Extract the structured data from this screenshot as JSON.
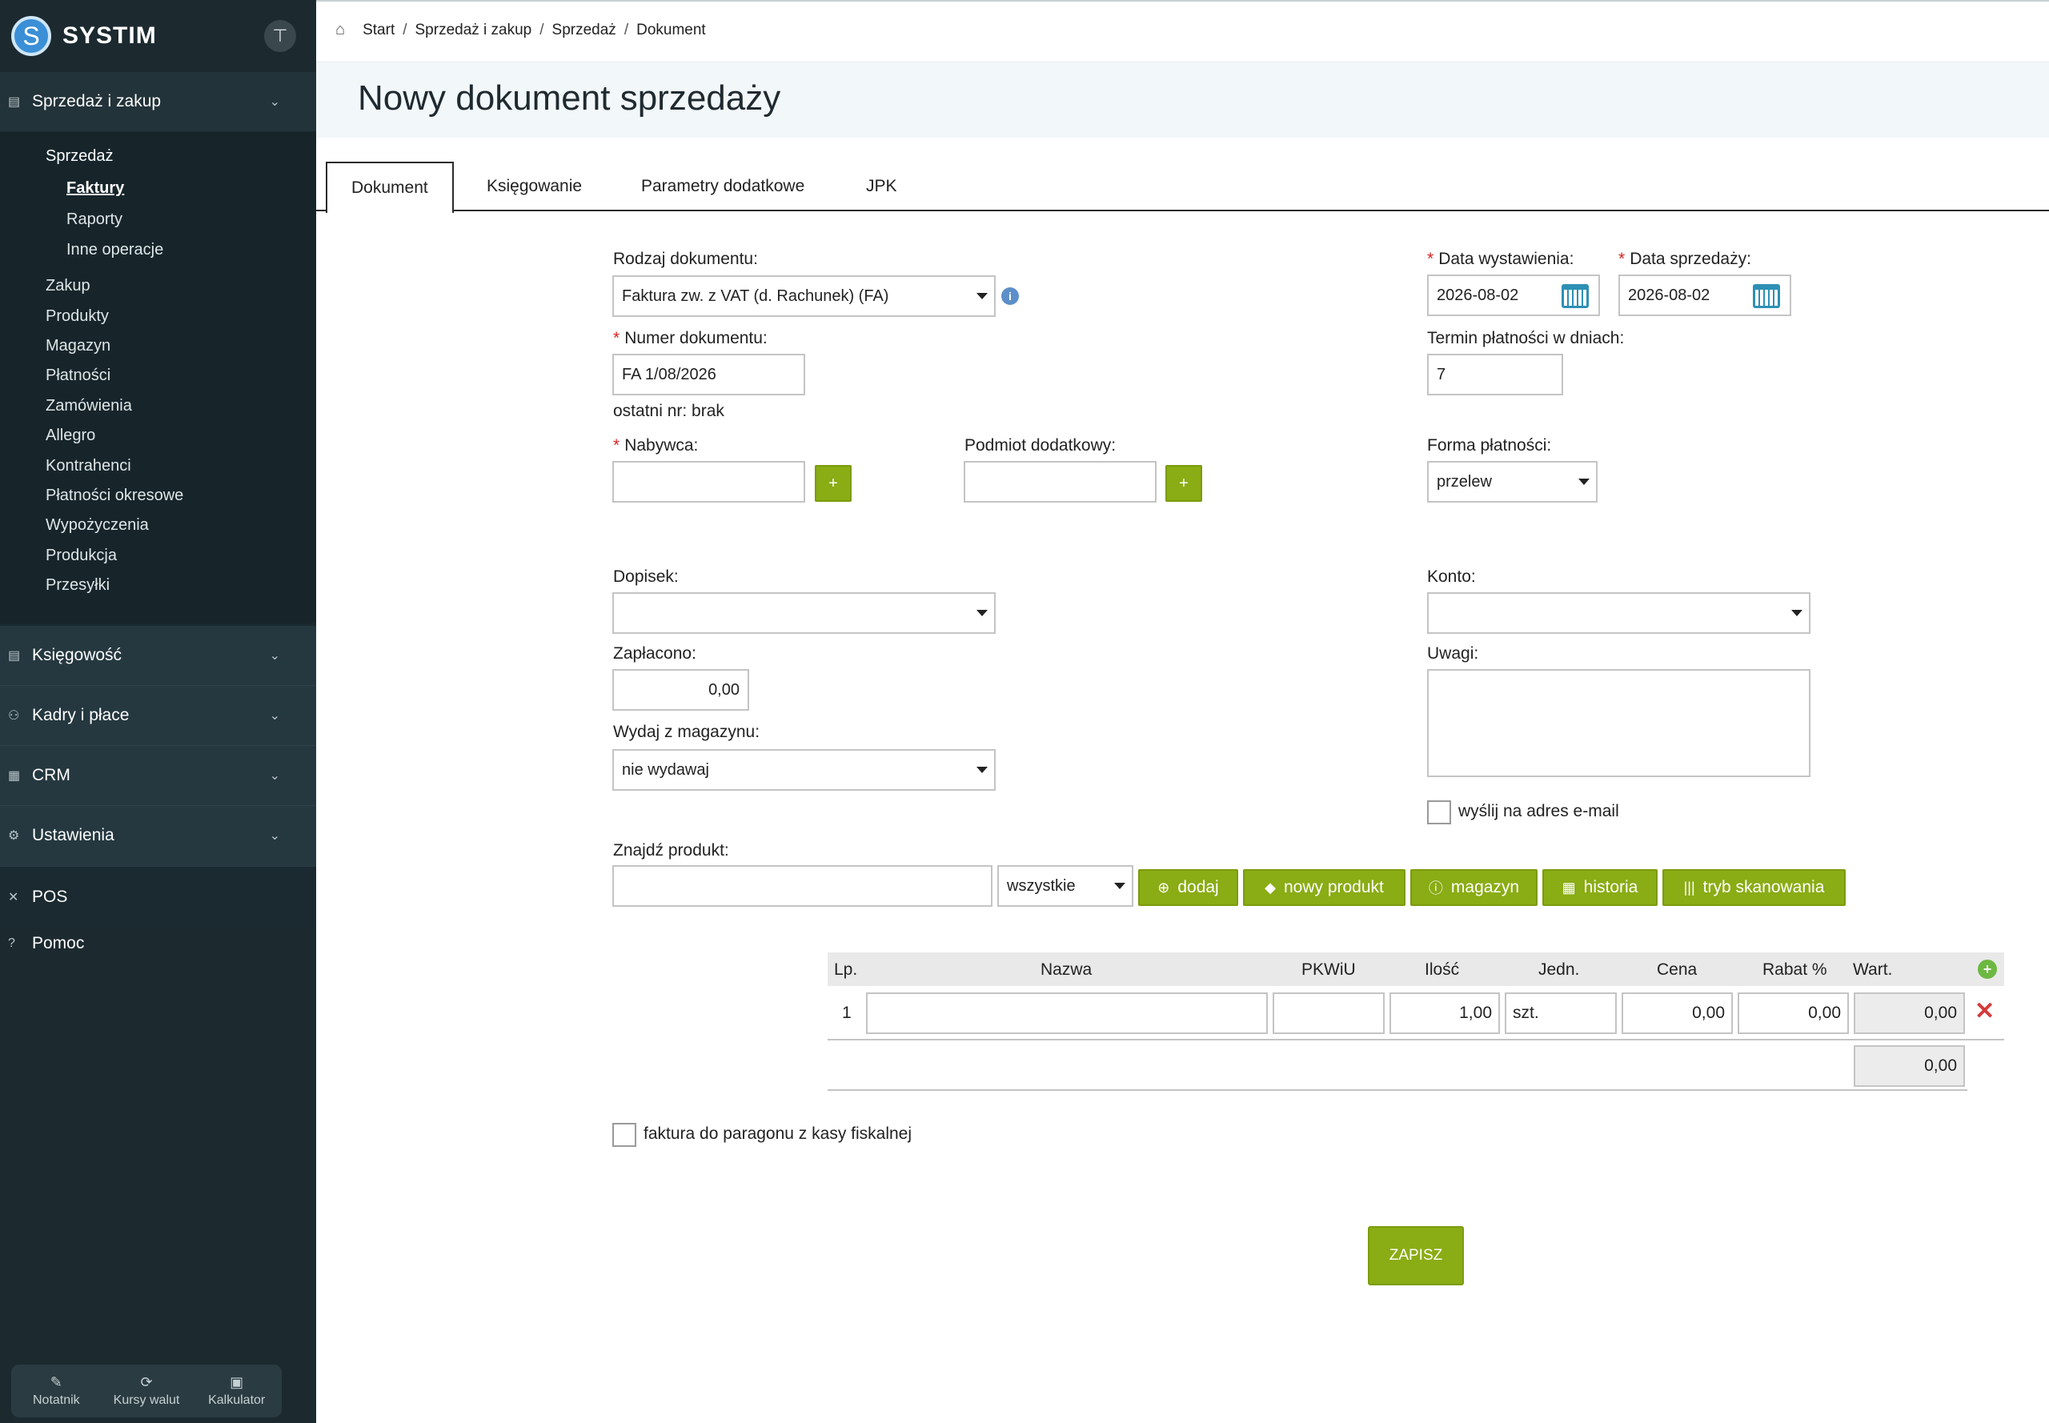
{
  "sidebar": {
    "brand": "SYSTIM",
    "logo_letter": "S",
    "sections": {
      "sales": "Sprzedaż i zakup",
      "accounting": "Księgowość",
      "hr": "Kadry i płace",
      "crm": "CRM",
      "settings": "Ustawienia",
      "pos": "POS",
      "help": "Pomoc"
    },
    "sub": {
      "sprzedaz": "Sprzedaż",
      "faktury": "Faktury",
      "raporty": "Raporty",
      "inne": "Inne operacje",
      "zakup": "Zakup",
      "produkty": "Produkty",
      "magazyn": "Magazyn",
      "platnosci": "Płatności",
      "zamowienia": "Zamówienia",
      "allegro": "Allegro",
      "kontrahenci": "Kontrahenci",
      "platnosci_okresowe": "Płatności okresowe",
      "wypozyczenia": "Wypożyczenia",
      "produkcja": "Produkcja",
      "przesylki": "Przesyłki"
    },
    "tools": {
      "notatnik": "Notatnik",
      "kursy": "Kursy walut",
      "kalkulator": "Kalkulator"
    }
  },
  "breadcrumb": {
    "start": "Start",
    "sales": "Sprzedaż i zakup",
    "sprzedaz": "Sprzedaż",
    "doc": "Dokument"
  },
  "page_title": "Nowy dokument sprzedaży",
  "tabs": {
    "dokument": "Dokument",
    "ksiegowanie": "Księgowanie",
    "parametry": "Parametry dodatkowe",
    "jpk": "JPK"
  },
  "form": {
    "rodzaj_label": "Rodzaj dokumentu:",
    "rodzaj_value": "Faktura zw. z VAT (d. Rachunek) (FA)",
    "numer_label": "Numer dokumentu:",
    "numer_value": "FA 1/08/2026",
    "ostatni": "ostatni nr: brak",
    "nabywca_label": "Nabywca:",
    "nabywca_value": "",
    "podmiot_label": "Podmiot dodatkowy:",
    "podmiot_value": "",
    "plus": "+",
    "data_wyst_label": "Data wystawienia:",
    "data_wyst_value": "2026-08-02",
    "data_sprz_label": "Data sprzedaży:",
    "data_sprz_value": "2026-08-02",
    "termin_label": "Termin płatności w dniach:",
    "termin_value": "7",
    "forma_label": "Forma płatności:",
    "forma_value": "przelew",
    "dopisek_label": "Dopisek:",
    "dopisek_value": "",
    "konto_label": "Konto:",
    "konto_value": "",
    "zaplacono_label": "Zapłacono:",
    "zaplacono_value": "0,00",
    "uwagi_label": "Uwagi:",
    "wydaj_label": "Wydaj z magazynu:",
    "wydaj_value": "nie wydawaj",
    "email_label": "wyślij na adres e-mail",
    "znajdz_label": "Znajdź produkt:",
    "znajdz_value": "",
    "filter_value": "wszystkie",
    "paragon_label": "faktura do paragonu z kasy fiskalnej"
  },
  "product_buttons": {
    "dodaj": "dodaj",
    "nowy": "nowy produkt",
    "magazyn": "magazyn",
    "historia": "historia",
    "tryb": "tryb skanowania"
  },
  "table": {
    "headers": {
      "lp": "Lp.",
      "nazwa": "Nazwa",
      "pkwiu": "PKWiU",
      "ilosc": "Ilość",
      "jedn": "Jedn.",
      "cena": "Cena",
      "rabat": "Rabat %",
      "wart": "Wart."
    },
    "rows": [
      {
        "lp": "1",
        "nazwa": "",
        "pkwiu": "",
        "ilosc": "1,00",
        "jedn": "szt.",
        "cena": "0,00",
        "rabat": "0,00",
        "wart": "0,00"
      }
    ],
    "total": "0,00"
  },
  "save_label": "ZAPISZ",
  "colors": {
    "sidebar": "#1c2a30",
    "accent_green": "#8aac14",
    "required": "#d62424"
  }
}
